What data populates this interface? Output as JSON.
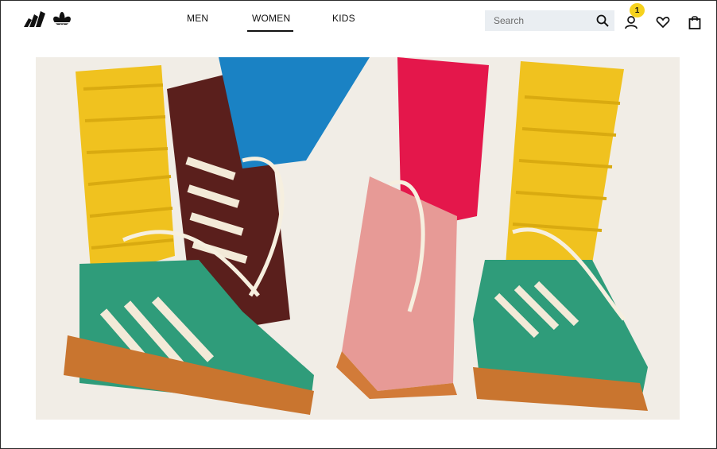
{
  "header": {
    "nav": [
      {
        "label": "MEN"
      },
      {
        "label": "WOMEN",
        "active": true
      },
      {
        "label": "KIDS"
      }
    ],
    "search": {
      "placeholder": "Search"
    },
    "account": {
      "badge_count": "1"
    },
    "icons": {
      "logo": "adidas-logo",
      "search": "search-icon",
      "account": "user-icon",
      "wishlist": "heart-icon",
      "bag": "shopping-bag-icon"
    },
    "colors": {
      "accent_badge": "#f6d21d",
      "search_bg": "#eaeef2"
    }
  },
  "hero": {
    "image": "colorful-socks-and-sneakers-photo"
  }
}
